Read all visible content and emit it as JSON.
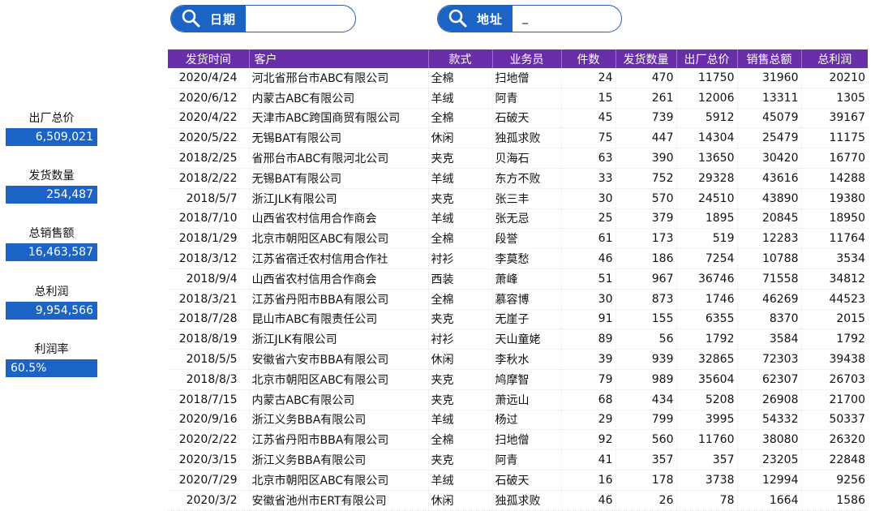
{
  "search": {
    "date": {
      "label": "日期",
      "value": ""
    },
    "address": {
      "label": "地址",
      "value": "_"
    }
  },
  "kpis": [
    {
      "label": "出厂总价",
      "value": "6,509,021"
    },
    {
      "label": "发货数量",
      "value": "254,487"
    },
    {
      "label": "总销售额",
      "value": "16,463,587"
    },
    {
      "label": "总利润",
      "value": "9,954,566"
    },
    {
      "label": "利润率",
      "value": "60.5%"
    }
  ],
  "table": {
    "headers": [
      "发货时间",
      "客户",
      "款式",
      "业务员",
      "件数",
      "发货数量",
      "出厂总价",
      "销售总额",
      "总利润"
    ],
    "rows": [
      [
        "2020/4/24",
        "河北省邢台市ABC有限公司",
        "全棉",
        "扫地僧",
        "24",
        "470",
        "11750",
        "31960",
        "20210"
      ],
      [
        "2020/6/12",
        "内蒙古ABC有限公司",
        "羊绒",
        "阿青",
        "15",
        "261",
        "12006",
        "13311",
        "1305"
      ],
      [
        "2020/4/22",
        "天津市ABC跨国商贸有限公司",
        "全棉",
        "石破天",
        "45",
        "739",
        "5912",
        "45079",
        "39167"
      ],
      [
        "2020/5/22",
        "无锡BAT有限公司",
        "休闲",
        "独孤求败",
        "75",
        "447",
        "14304",
        "25479",
        "11175"
      ],
      [
        "2018/2/25",
        "省邢台市ABC有限河北公司",
        "夹克",
        "贝海石",
        "63",
        "390",
        "13650",
        "30420",
        "16770"
      ],
      [
        "2018/2/22",
        "无锡BAT有限公司",
        "羊绒",
        "东方不败",
        "33",
        "752",
        "29328",
        "43616",
        "14288"
      ],
      [
        "2018/5/7",
        "浙江JLK有限公司",
        "夹克",
        "张三丰",
        "30",
        "570",
        "24510",
        "43890",
        "19380"
      ],
      [
        "2018/7/10",
        "山西省农村信用合作商会",
        "羊绒",
        "张无忌",
        "25",
        "379",
        "1895",
        "20845",
        "18950"
      ],
      [
        "2018/1/29",
        "北京市朝阳区ABC有限公司",
        "全棉",
        "段誉",
        "61",
        "173",
        "519",
        "12283",
        "11764"
      ],
      [
        "2018/3/12",
        "江苏省宿迁农村信用合作社",
        "衬衫",
        "李莫愁",
        "46",
        "186",
        "7254",
        "10788",
        "3534"
      ],
      [
        "2018/9/4",
        "山西省农村信用合作商会",
        "西装",
        "萧峰",
        "51",
        "967",
        "36746",
        "71558",
        "34812"
      ],
      [
        "2018/3/21",
        "江苏省丹阳市BBA有限公司",
        "全棉",
        "慕容博",
        "30",
        "873",
        "1746",
        "46269",
        "44523"
      ],
      [
        "2018/7/28",
        "昆山市ABC有限责任公司",
        "夹克",
        "无崖子",
        "91",
        "155",
        "6355",
        "8370",
        "2015"
      ],
      [
        "2018/8/19",
        "浙江JLK有限公司",
        "衬衫",
        "天山童姥",
        "89",
        "56",
        "1792",
        "3584",
        "1792"
      ],
      [
        "2018/5/5",
        "安徽省六安市BBA有限公司",
        "休闲",
        "李秋水",
        "39",
        "939",
        "32865",
        "72303",
        "39438"
      ],
      [
        "2018/8/3",
        "北京市朝阳区ABC有限公司",
        "夹克",
        "鸠摩智",
        "79",
        "989",
        "35604",
        "62307",
        "26703"
      ],
      [
        "2018/7/15",
        "内蒙古ABC有限公司",
        "夹克",
        "萧远山",
        "68",
        "434",
        "5208",
        "26908",
        "21700"
      ],
      [
        "2020/9/16",
        "浙江义务BBA有限公司",
        "羊绒",
        "杨过",
        "29",
        "799",
        "3995",
        "54332",
        "50337"
      ],
      [
        "2020/2/22",
        "江苏省丹阳市BBA有限公司",
        "全棉",
        "扫地僧",
        "92",
        "560",
        "11760",
        "38080",
        "26320"
      ],
      [
        "2020/3/15",
        "浙江义务BBA有限公司",
        "夹克",
        "阿青",
        "41",
        "357",
        "357",
        "23205",
        "22848"
      ],
      [
        "2020/7/29",
        "北京市朝阳区ABC有限公司",
        "羊绒",
        "石破天",
        "16",
        "178",
        "3738",
        "12994",
        "9256"
      ],
      [
        "2020/3/2",
        "安徽省池州市ERT有限公司",
        "休闲",
        "独孤求败",
        "46",
        "26",
        "78",
        "1664",
        "1586"
      ]
    ]
  },
  "colors": {
    "accent": "#1b63c4",
    "header": "#6a2fa8"
  }
}
